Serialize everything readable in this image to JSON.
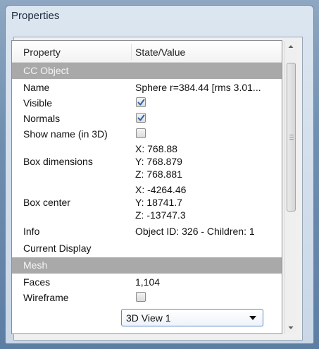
{
  "window": {
    "title": "Properties"
  },
  "table": {
    "headers": {
      "property": "Property",
      "value": "State/Value"
    },
    "section_cc_object": "CC Object",
    "rows": {
      "name": {
        "label": "Name",
        "value": "Sphere r=384.44 [rms 3.01..."
      },
      "visible": {
        "label": "Visible",
        "checked": true
      },
      "normals": {
        "label": "Normals",
        "checked": true
      },
      "show_name": {
        "label": "Show name (in 3D)",
        "checked": false
      },
      "box_dimensions": {
        "label": "Box dimensions",
        "x": "X: 768.88",
        "y": "Y: 768.879",
        "z": "Z: 768.881"
      },
      "box_center": {
        "label": "Box center",
        "x": "X: -4264.46",
        "y": "Y: 18741.7",
        "z": "Z: -13747.3"
      },
      "info": {
        "label": "Info",
        "value": "Object ID: 326 - Children: 1"
      },
      "current_display": {
        "label": "Current Display",
        "value": "3D View 1"
      }
    },
    "section_mesh": "Mesh",
    "mesh_rows": {
      "faces": {
        "label": "Faces",
        "value": "1,104"
      },
      "wireframe": {
        "label": "Wireframe",
        "checked": false
      }
    }
  },
  "colors": {
    "section_bg": "#a9a9a9",
    "check": "#2f5fa8",
    "combo_border": "#5a88c8"
  },
  "icons": [
    "check-icon",
    "dropdown-arrow-icon",
    "scroll-up-arrow-icon",
    "scroll-down-arrow-icon",
    "scroll-grip-icon"
  ]
}
